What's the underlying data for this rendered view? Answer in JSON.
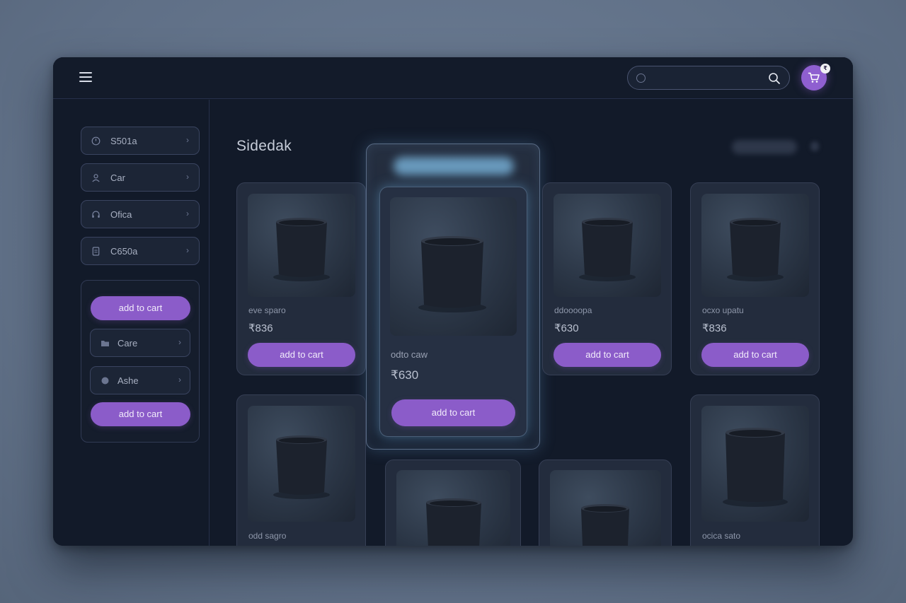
{
  "header": {
    "search_placeholder": "",
    "cart_badge": "₹"
  },
  "sidebar": {
    "items": [
      {
        "label": "S501a",
        "icon": "clock-icon"
      },
      {
        "label": "Car",
        "icon": "user-icon"
      },
      {
        "label": "Ofica",
        "icon": "headset-icon"
      },
      {
        "label": "C650a",
        "icon": "document-icon"
      }
    ],
    "panel": {
      "top_button": "add to cart",
      "items": [
        {
          "label": "Care",
          "icon": "folder-icon"
        },
        {
          "label": "Ashe",
          "icon": "circle-icon"
        }
      ],
      "bottom_button": "add to cart"
    }
  },
  "main": {
    "title": "Sidedak",
    "featured": {
      "name": "odto caw",
      "price": "₹630",
      "button": "add to cart"
    },
    "products": [
      {
        "name": "eve sparo",
        "price": "₹836",
        "button": "add to cart"
      },
      {
        "name": "ddoooopa",
        "price": "₹630",
        "button": "add to cart"
      },
      {
        "name": "ocxo upatu",
        "price": "₹836",
        "button": "add to cart"
      },
      {
        "name": "odd sagro",
        "price": "",
        "button": ""
      },
      {
        "name": "",
        "price": "",
        "button": ""
      },
      {
        "name": "",
        "price": "",
        "button": ""
      },
      {
        "name": "ocica sato",
        "price": "",
        "button": ""
      }
    ]
  },
  "colors": {
    "accent": "#8b5cc9",
    "window_bg": "#121a29",
    "card_bg": "#232c3d",
    "glow": "#7fbde6"
  }
}
